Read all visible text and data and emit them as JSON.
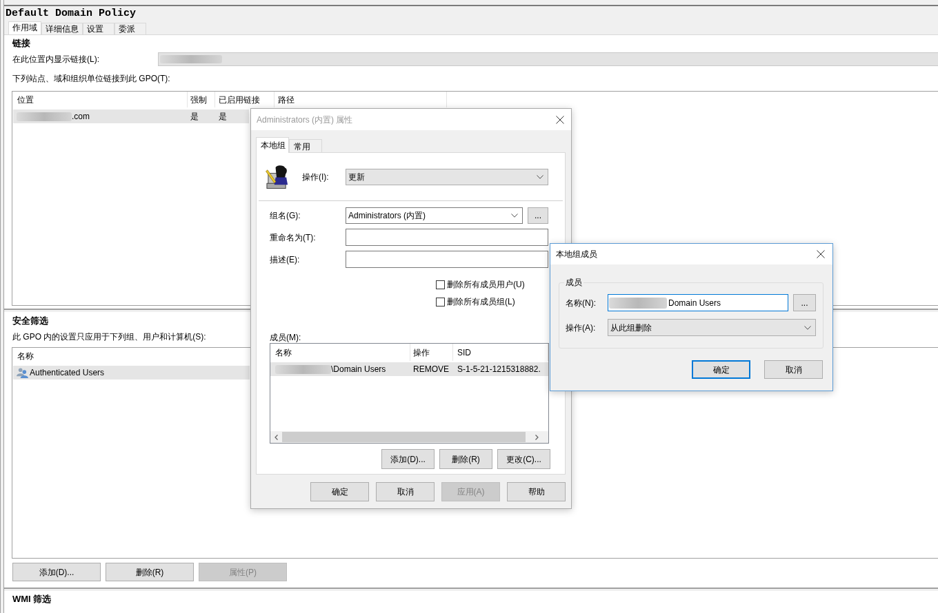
{
  "window": {
    "title": "Default Domain Policy"
  },
  "tabs": [
    {
      "label": "作用域",
      "selected": true
    },
    {
      "label": "详细信息",
      "selected": false
    },
    {
      "label": "设置",
      "selected": false
    },
    {
      "label": "委派",
      "selected": false
    }
  ],
  "links": {
    "heading": "链接",
    "display_label": "在此位置内显示链接(L):",
    "list_label": "下列站点、域和组织单位链接到此 GPO(T):",
    "columns": [
      "位置",
      "强制",
      "已启用链接",
      "路径"
    ],
    "rows": [
      {
        "location": ".com",
        "enforced": "是",
        "link_enabled": "是",
        "selected": true
      }
    ]
  },
  "security_filtering": {
    "heading": "安全筛选",
    "description": "此 GPO 内的设置只应用于下列组、用户和计算机(S):",
    "columns": [
      "名称"
    ],
    "rows": [
      {
        "name": "Authenticated Users",
        "selected": true
      }
    ],
    "buttons": [
      {
        "label": "添加(D)...",
        "disabled": false
      },
      {
        "label": "删除(R)",
        "disabled": false
      },
      {
        "label": "属性(P)",
        "disabled": true
      }
    ]
  },
  "wmi_filtering": {
    "heading": "WMI 筛选"
  },
  "properties_dialog": {
    "title": "Administrators (内置) 属性",
    "active": false,
    "tabs": [
      {
        "label": "本地组",
        "selected": true
      },
      {
        "label": "常用",
        "selected": false
      }
    ],
    "action": {
      "label": "操作(I):",
      "value": "更新"
    },
    "group_name": {
      "label": "组名(G):",
      "value": "Administrators (内置)",
      "browse": "..."
    },
    "rename_to": {
      "label": "重命名为(T):"
    },
    "description": {
      "label": "描述(E):"
    },
    "checkboxes": [
      {
        "label": "删除所有成员用户(U)",
        "checked": false
      },
      {
        "label": "删除所有成员组(L)",
        "checked": false
      }
    ],
    "members": {
      "label": "成员(M):",
      "columns": [
        "名称",
        "操作",
        "SID"
      ],
      "rows": [
        {
          "name": "\\Domain Users",
          "action": "REMOVE",
          "sid": "S-1-5-21-1215318882.",
          "selected": true
        }
      ],
      "buttons": [
        "添加(D)...",
        "删除(R)",
        "更改(C)..."
      ]
    },
    "buttons": [
      {
        "label": "确定",
        "disabled": false
      },
      {
        "label": "取消",
        "disabled": false
      },
      {
        "label": "应用(A)",
        "disabled": true
      },
      {
        "label": "帮助",
        "disabled": false
      }
    ]
  },
  "member_dialog": {
    "title": "本地组成员",
    "active": true,
    "group_label": "成员",
    "name": {
      "label": "名称(N):",
      "value": "Domain Users",
      "focused": true,
      "browse": "..."
    },
    "action": {
      "label": "操作(A):",
      "value": "从此组删除"
    },
    "buttons": [
      {
        "label": "确定",
        "default": true
      },
      {
        "label": "取消",
        "default": false
      }
    ]
  }
}
